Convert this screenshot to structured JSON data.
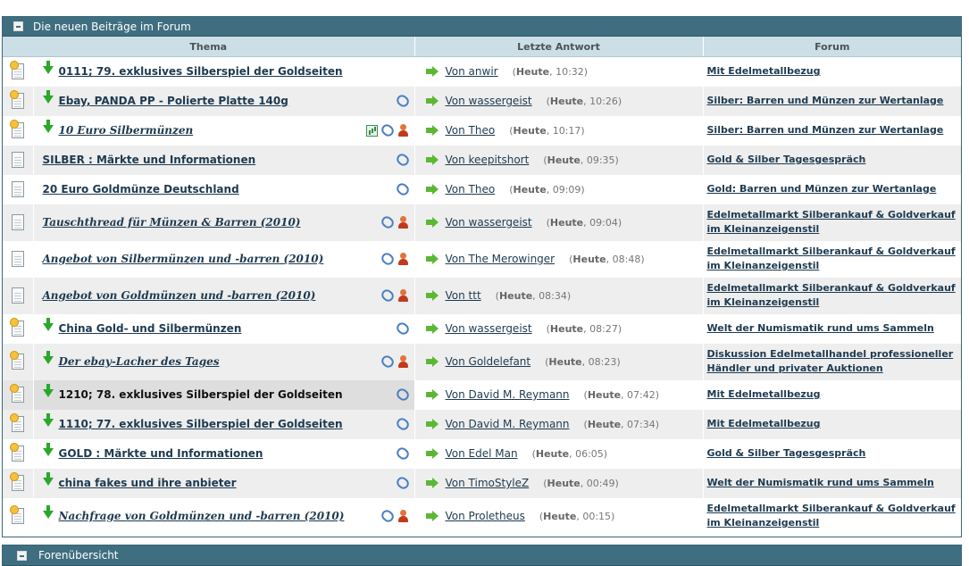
{
  "section": {
    "title": "Die neuen Beiträge im Forum"
  },
  "columns": {
    "thema": "Thema",
    "letzte": "Letzte Antwort",
    "forum": "Forum"
  },
  "rows": [
    {
      "title": "0111; 79. exklusives Silberspiel der Goldseiten",
      "new": true,
      "arrow": true,
      "italic": false,
      "underline": true,
      "attach": false,
      "poll": false,
      "person": false,
      "author": "Von anwir",
      "day": "Heute",
      "time": ", 10:32)",
      "forum": "Mit Edelmetallbezug"
    },
    {
      "title": "Ebay, PANDA PP - Polierte Platte 140g",
      "new": true,
      "arrow": true,
      "italic": false,
      "underline": true,
      "attach": true,
      "poll": false,
      "person": false,
      "author": "Von wassergeist",
      "day": "Heute",
      "time": ", 10:26)",
      "forum": "Silber: Barren und Münzen zur Wertanlage"
    },
    {
      "title": "10 Euro Silbermünzen",
      "new": true,
      "arrow": true,
      "italic": true,
      "underline": true,
      "attach": true,
      "poll": true,
      "person": true,
      "author": "Von Theo",
      "day": "Heute",
      "time": ", 10:17)",
      "forum": "Silber: Barren und Münzen zur Wertanlage"
    },
    {
      "title": "SILBER : Märkte und Informationen",
      "new": false,
      "arrow": false,
      "italic": false,
      "underline": true,
      "attach": true,
      "poll": false,
      "person": false,
      "author": "Von keepitshort",
      "day": "Heute",
      "time": ", 09:35)",
      "forum": "Gold & Silber Tagesgespräch"
    },
    {
      "title": "20 Euro Goldmünze Deutschland",
      "new": false,
      "arrow": false,
      "italic": false,
      "underline": true,
      "attach": true,
      "poll": false,
      "person": false,
      "author": "Von Theo",
      "day": "Heute",
      "time": ", 09:09)",
      "forum": "Gold: Barren und Münzen zur Wertanlage"
    },
    {
      "title": "Tauschthread für Münzen & Barren (2010)",
      "new": false,
      "arrow": false,
      "italic": true,
      "underline": true,
      "attach": true,
      "poll": false,
      "person": true,
      "author": "Von wassergeist",
      "day": "Heute",
      "time": ", 09:04)",
      "forum": "Edelmetallmarkt Silberankauf & Goldverkauf im Kleinanzeigenstil"
    },
    {
      "title": "Angebot von Silbermünzen und -barren (2010)",
      "new": false,
      "arrow": false,
      "italic": true,
      "underline": true,
      "attach": true,
      "poll": false,
      "person": true,
      "author": "Von The Merowinger",
      "day": "Heute",
      "time": ", 08:48)",
      "forum": "Edelmetallmarkt Silberankauf & Goldverkauf im Kleinanzeigenstil"
    },
    {
      "title": "Angebot von Goldmünzen und -barren (2010)",
      "new": false,
      "arrow": false,
      "italic": true,
      "underline": true,
      "attach": true,
      "poll": false,
      "person": true,
      "author": "Von ttt",
      "day": "Heute",
      "time": ", 08:34)",
      "forum": "Edelmetallmarkt Silberankauf & Goldverkauf im Kleinanzeigenstil"
    },
    {
      "title": "China Gold- und Silbermünzen",
      "new": true,
      "arrow": true,
      "italic": false,
      "underline": true,
      "attach": true,
      "poll": false,
      "person": false,
      "author": "Von wassergeist",
      "day": "Heute",
      "time": ", 08:27)",
      "forum": "Welt der Numismatik rund ums Sammeln"
    },
    {
      "title": "Der ebay-Lacher des Tages",
      "new": true,
      "arrow": true,
      "italic": true,
      "underline": true,
      "attach": true,
      "poll": false,
      "person": true,
      "author": "Von Goldelefant",
      "day": "Heute",
      "time": ", 08:23)",
      "forum": "Diskussion Edelmetallhandel professioneller Händler und privater Auktionen"
    },
    {
      "title": "1210; 78. exklusives Silberspiel der Goldseiten",
      "new": true,
      "arrow": true,
      "italic": false,
      "underline": false,
      "attach": true,
      "poll": false,
      "person": false,
      "author": "Von David M. Reymann",
      "day": "Heute",
      "time": ", 07:42)",
      "forum": "Mit Edelmetallbezug"
    },
    {
      "title": "1110; 77. exklusives Silberspiel der Goldseiten",
      "new": true,
      "arrow": true,
      "italic": false,
      "underline": true,
      "attach": true,
      "poll": false,
      "person": false,
      "author": "Von David M. Reymann",
      "day": "Heute",
      "time": ", 07:34)",
      "forum": "Mit Edelmetallbezug"
    },
    {
      "title": "GOLD : Märkte und Informationen",
      "new": true,
      "arrow": true,
      "italic": false,
      "underline": true,
      "attach": true,
      "poll": false,
      "person": false,
      "author": "Von Edel Man",
      "day": "Heute",
      "time": ", 06:05)",
      "forum": "Gold & Silber Tagesgespräch"
    },
    {
      "title": "china fakes und ihre anbieter",
      "new": true,
      "arrow": true,
      "italic": false,
      "underline": true,
      "attach": true,
      "poll": false,
      "person": false,
      "author": "Von TimoStyleZ",
      "day": "Heute",
      "time": ", 00:49)",
      "forum": "Welt der Numismatik rund ums Sammeln"
    },
    {
      "title": "Nachfrage von Goldmünzen und -barren (2010)",
      "new": true,
      "arrow": true,
      "italic": true,
      "underline": true,
      "attach": true,
      "poll": false,
      "person": true,
      "author": "Von Proletheus",
      "day": "Heute",
      "time": ", 00:15)",
      "forum": "Edelmetallmarkt Silberankauf & Goldverkauf im Kleinanzeigenstil"
    }
  ],
  "footer": {
    "title": "Forenübersicht"
  }
}
